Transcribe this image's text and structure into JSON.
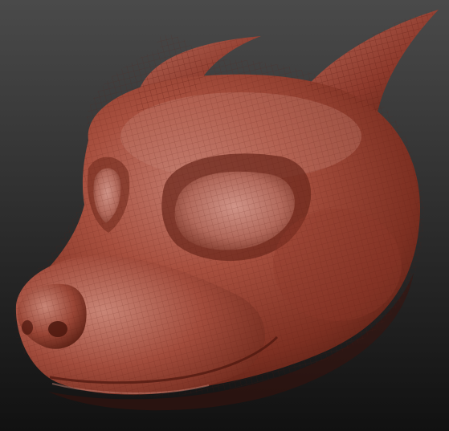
{
  "scene": {
    "subject": "sculpted-creature-head",
    "material": "red-wax",
    "colors": {
      "background_top": "#4a4a4a",
      "background_bottom": "#111111",
      "material_highlight": "#c8857a",
      "material_light": "#b86455",
      "material_mid": "#9e4434",
      "material_dark": "#5e2218",
      "material_deep": "#3a130c",
      "wireframe": "#7a2a1e"
    }
  }
}
